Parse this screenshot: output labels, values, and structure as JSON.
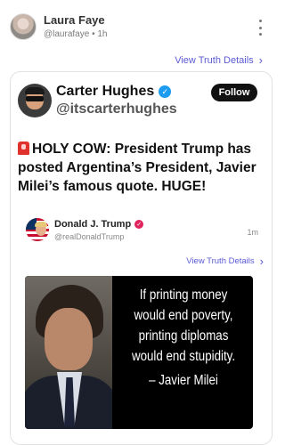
{
  "outer_post": {
    "author_name": "Laura Faye",
    "author_handle": "@laurafaye",
    "separator": "•",
    "time": "1h",
    "view_details_label": "View Truth Details"
  },
  "quoted_post": {
    "author_name": "Carter Hughes",
    "author_handle": "@itscarterhughes",
    "follow_label": "Follow",
    "text": "HOLY COW:   President Trump has posted Argentina’s President, Javier Milei’s famous quote. HUGE!",
    "text_icon": "siren-emoji-icon",
    "verified_color": "#1d9bf0"
  },
  "embedded_truth": {
    "author_name": "Donald J. Trump",
    "author_handle": "@realDonaldTrump",
    "time": "1m",
    "view_details_label": "View Truth Details",
    "verified_color": "#e0245e",
    "image": {
      "quote_lines": [
        "If printing money",
        "would end poverty,",
        "printing diplomas",
        "would end stupidity."
      ],
      "attribution": "– Javier Milei"
    }
  },
  "colors": {
    "link": "#5b5bd6",
    "follow_button_bg": "#111111"
  }
}
